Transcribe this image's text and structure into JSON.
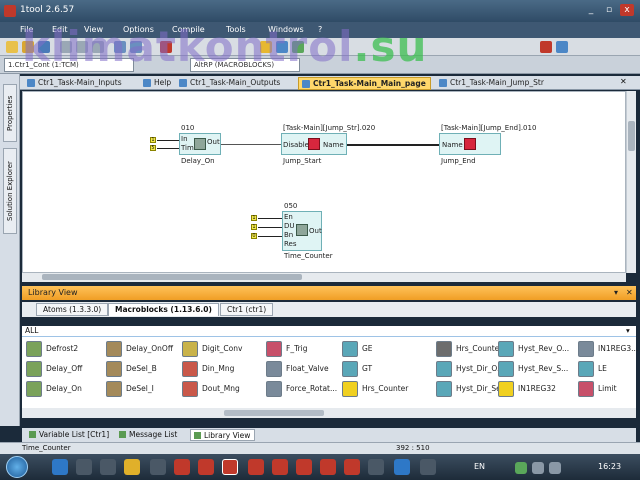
{
  "window": {
    "title": "1tool 2.6.57",
    "minimize": "_",
    "maximize": "▫",
    "close": "x"
  },
  "menu": [
    "File",
    "Edit",
    "View",
    "Options",
    "Compile",
    "Tools",
    "Windows",
    "?"
  ],
  "addr": {
    "left_combo": "1.Ctr1_Cont (1:TCM)",
    "mid_combo": "AltRP (MACROBLOCKS)"
  },
  "watermark": {
    "main": "klimatkontrol",
    "suffix": ".su"
  },
  "left_dock": {
    "properties": "Properties",
    "solution_explorer": "Solution Explorer"
  },
  "doc_tabs": [
    "Ctr1_Task-Main_Inputs",
    "Help",
    "Ctr1_Task-Main_Outputs",
    "Ctr1_Task-Main_Main_page",
    "Ctr1_Task-Main_Jump_Str"
  ],
  "active_doc_tab": 3,
  "diagram": {
    "delay_on": {
      "id": "010",
      "in1": "In",
      "in2": "Time",
      "out": "Out",
      "name": "Delay_On",
      "c1": "1",
      "c2": "5"
    },
    "jump_start": {
      "header": "[Task-Main][Jump_Str].020",
      "in": "Disable",
      "out": "Name",
      "name": "Jump_Start"
    },
    "jump_end": {
      "header": "[Task-Main][Jump_End].010",
      "in": "Name",
      "name": "Jump_End"
    },
    "time_counter": {
      "id": "050",
      "in1": "En",
      "in2": "DU",
      "in3": "Bn",
      "in4": "Res",
      "out": "Out",
      "name": "Time_Counter",
      "c1": "1",
      "c2": "1",
      "c3": "0"
    }
  },
  "library": {
    "title": "Library View",
    "tabs": [
      "Atoms (1.3.3.0)",
      "Macroblocks (1.13.6.0)",
      "Ctr1 (ctr1)"
    ],
    "active_tab": 1,
    "filter": "ALL",
    "items": [
      [
        "Defrost2",
        "Delay_OnOff",
        "Digit_Conv",
        "F_Trig",
        "GE",
        "Hrs_Counter...",
        "Hyst_Rev_O...",
        "IN1REG3..."
      ],
      [
        "Delay_Off",
        "DeSel_B",
        "Din_Mng",
        "Float_Valve",
        "GT",
        "Hyst_Dir_O...",
        "Hyst_Rev_S...",
        "LE"
      ],
      [
        "Delay_On",
        "DeSel_I",
        "Dout_Mng",
        "Force_Rotat...",
        "Hrs_Counter",
        "Hyst_Dir_Se...",
        "IN1REG32",
        "Limit"
      ]
    ],
    "icon_colors": [
      [
        "#7aa25a",
        "#a48a5a",
        "#c9b34a",
        "#c7506a",
        "#5aa7b8",
        "#6d6d6d",
        "#5aa7b8",
        "#7a8a9a"
      ],
      [
        "#7aa25a",
        "#a48a5a",
        "#c9584a",
        "#7a8a9a",
        "#5aa7b8",
        "#5aa7b8",
        "#5aa7b8",
        "#5aa7b8"
      ],
      [
        "#7aa25a",
        "#a48a5a",
        "#c9584a",
        "#7a8a9a",
        "#f0d020",
        "#5aa7b8",
        "#f0d020",
        "#c7506a"
      ]
    ]
  },
  "bottom_tabs": [
    "Variable List [Ctr1]",
    "Message List",
    "Library View"
  ],
  "active_bottom_tab": 2,
  "status": {
    "left": "Time_Counter",
    "coords": "392 : 510"
  },
  "tray": {
    "lang": "EN",
    "time": "16:23"
  }
}
